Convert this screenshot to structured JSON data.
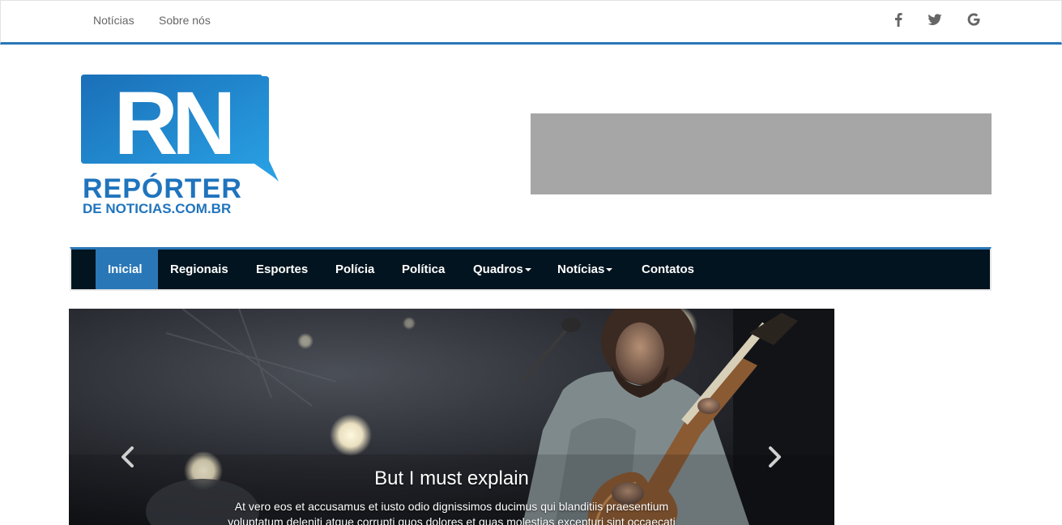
{
  "topbar": {
    "links": [
      "Notícias",
      "Sobre nós"
    ],
    "social_icons": [
      "facebook-icon",
      "twitter-icon",
      "google-icon"
    ]
  },
  "logo": {
    "mark": "RN",
    "line1": "REPÓRTER",
    "line2": "DE NOTICIAS.COM.BR"
  },
  "nav": {
    "items": [
      {
        "label": "Inicial",
        "active": true,
        "dropdown": false
      },
      {
        "label": "Regionais",
        "active": false,
        "dropdown": false
      },
      {
        "label": "Esportes",
        "active": false,
        "dropdown": false
      },
      {
        "label": "Polícia",
        "active": false,
        "dropdown": false
      },
      {
        "label": "Política",
        "active": false,
        "dropdown": false
      },
      {
        "label": "Quadros",
        "active": false,
        "dropdown": true
      },
      {
        "label": "Notícias",
        "active": false,
        "dropdown": true
      },
      {
        "label": "Contatos",
        "active": false,
        "dropdown": false
      }
    ]
  },
  "carousel": {
    "title": "But I must explain",
    "text": "At vero eos et accusamus et iusto odio dignissimos ducimus qui blanditiis praesentium voluptatum deleniti atque corrupti quos dolores et quas molestias excepturi sint occaecati"
  },
  "colors": {
    "accent": "#2a77b8",
    "nav_bg": "#02141f",
    "ad_bg": "#a6a6a6",
    "logo_blue": "#1f87d2"
  }
}
